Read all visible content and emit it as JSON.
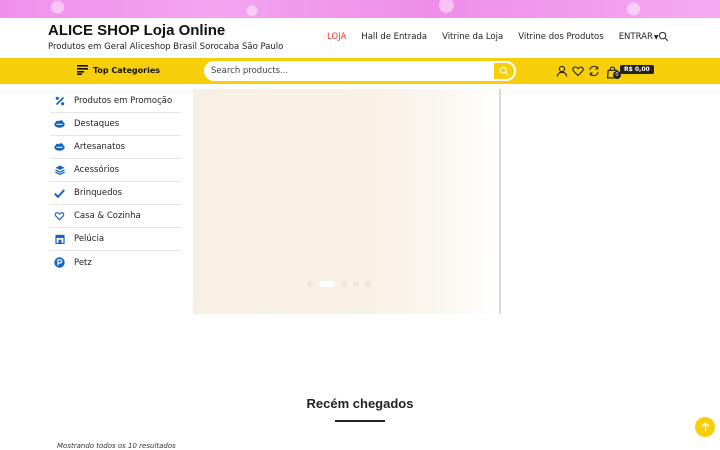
{
  "brand": {
    "title": "ALICE SHOP Loja Online",
    "subtitle": "Produtos em Geral Aliceshop Brasil Sorocaba São Paulo"
  },
  "nav": {
    "items": [
      {
        "label": "LOJA",
        "active": true
      },
      {
        "label": "Hall de Entrada"
      },
      {
        "label": "Vitrine da Loja"
      },
      {
        "label": "Vitrine dos Produtos"
      },
      {
        "label": "ENTRAR"
      }
    ]
  },
  "toolbar": {
    "top_categories": "Top Categories",
    "search_placeholder": "Search products...",
    "cart_count": "0",
    "cart_total": "R$ 0,00"
  },
  "sidebar": {
    "items": [
      {
        "label": "Produtos em Promoção",
        "icon": "percent-icon"
      },
      {
        "label": "Destaques",
        "icon": "salesforce-cloud-icon"
      },
      {
        "label": "Artesanatos",
        "icon": "salesforce-cloud-icon"
      },
      {
        "label": "Acessórios",
        "icon": "layers-icon"
      },
      {
        "label": "Brinquedos",
        "icon": "check-icon"
      },
      {
        "label": "Casa & Cozinha",
        "icon": "heart-icon"
      },
      {
        "label": "Pelúcia",
        "icon": "store-icon"
      },
      {
        "label": "Petz",
        "icon": "paypal-icon"
      }
    ]
  },
  "section": {
    "title": "Recém chegados",
    "results": "Mostrando todos os 10 resultados"
  },
  "colors": {
    "accent": "#f6cf0a",
    "active_nav": "#e53935",
    "icon_blue": "#1565c0"
  }
}
